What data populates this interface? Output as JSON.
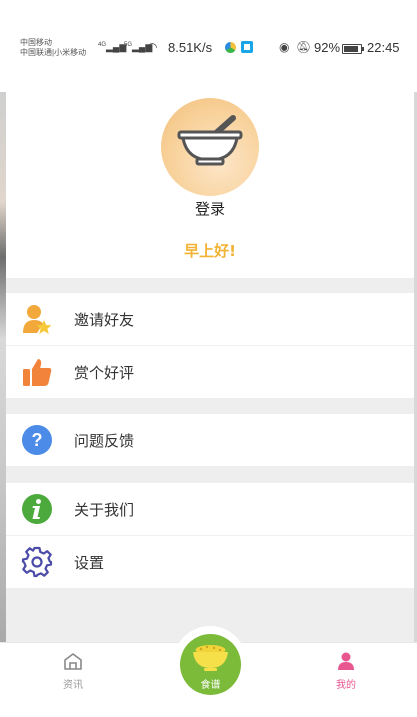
{
  "status_bar": {
    "carrier_1": "中国移动",
    "carrier_2": "中国联通|小米移动",
    "signal_1": "4G",
    "signal_2": "5G",
    "net_speed": "8.51K/s",
    "battery": "92%",
    "time": "22:45"
  },
  "profile": {
    "login": "登录",
    "greeting": "早上好!"
  },
  "menu": {
    "invite": "邀请好友",
    "rate": "赏个好评",
    "feedback": "问题反馈",
    "about": "关于我们",
    "settings": "设置"
  },
  "bottom_nav": {
    "news": "资讯",
    "recipes": "食谱",
    "mine": "我的"
  },
  "colors": {
    "accent_yellow": "#f2b233",
    "active_tab": "#e8578f",
    "center_button": "#7cba3a"
  }
}
